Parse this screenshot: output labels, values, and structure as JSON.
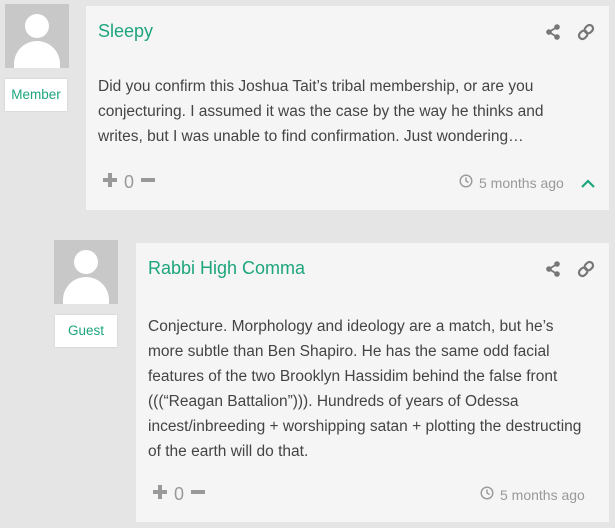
{
  "comments": [
    {
      "author": "Sleepy",
      "role": "Member",
      "text": "Did you confirm this Joshua Tait’s tribal membership, or are you conjecturing. I assumed it was the case by the way he thinks and writes, but I was unable to find confirmation. Just wondering…",
      "votes": "0",
      "time": "5 months ago"
    },
    {
      "author": "Rabbi High Comma",
      "role": "Guest",
      "text": "Conjecture. Morphology and ideology are a match, but he’s more subtle than Ben Shapiro. He has the same odd facial features of the two Brooklyn Hassidim behind the false front (((“Reagan Battalion”))). Hundreds of years of Odessa incest/inbreeding + worshipping satan + plotting the destructing of the earth will do that.",
      "votes": "0",
      "time": "5 months ago"
    }
  ],
  "colors": {
    "accent": "#1da57d",
    "icon": "#777777",
    "muted": "#999999"
  }
}
